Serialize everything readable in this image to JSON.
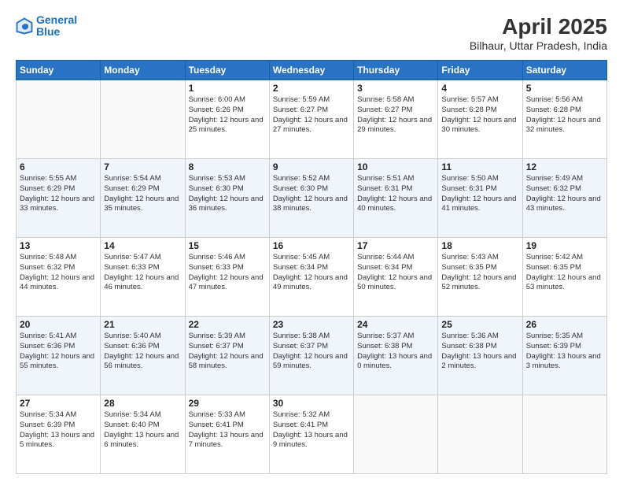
{
  "logo": {
    "line1": "General",
    "line2": "Blue"
  },
  "title": "April 2025",
  "location": "Bilhaur, Uttar Pradesh, India",
  "days": [
    "Sunday",
    "Monday",
    "Tuesday",
    "Wednesday",
    "Thursday",
    "Friday",
    "Saturday"
  ],
  "weeks": [
    [
      {
        "day": "",
        "sunrise": "",
        "sunset": "",
        "daylight": ""
      },
      {
        "day": "",
        "sunrise": "",
        "sunset": "",
        "daylight": ""
      },
      {
        "day": "1",
        "sunrise": "Sunrise: 6:00 AM",
        "sunset": "Sunset: 6:26 PM",
        "daylight": "Daylight: 12 hours and 25 minutes."
      },
      {
        "day": "2",
        "sunrise": "Sunrise: 5:59 AM",
        "sunset": "Sunset: 6:27 PM",
        "daylight": "Daylight: 12 hours and 27 minutes."
      },
      {
        "day": "3",
        "sunrise": "Sunrise: 5:58 AM",
        "sunset": "Sunset: 6:27 PM",
        "daylight": "Daylight: 12 hours and 29 minutes."
      },
      {
        "day": "4",
        "sunrise": "Sunrise: 5:57 AM",
        "sunset": "Sunset: 6:28 PM",
        "daylight": "Daylight: 12 hours and 30 minutes."
      },
      {
        "day": "5",
        "sunrise": "Sunrise: 5:56 AM",
        "sunset": "Sunset: 6:28 PM",
        "daylight": "Daylight: 12 hours and 32 minutes."
      }
    ],
    [
      {
        "day": "6",
        "sunrise": "Sunrise: 5:55 AM",
        "sunset": "Sunset: 6:29 PM",
        "daylight": "Daylight: 12 hours and 33 minutes."
      },
      {
        "day": "7",
        "sunrise": "Sunrise: 5:54 AM",
        "sunset": "Sunset: 6:29 PM",
        "daylight": "Daylight: 12 hours and 35 minutes."
      },
      {
        "day": "8",
        "sunrise": "Sunrise: 5:53 AM",
        "sunset": "Sunset: 6:30 PM",
        "daylight": "Daylight: 12 hours and 36 minutes."
      },
      {
        "day": "9",
        "sunrise": "Sunrise: 5:52 AM",
        "sunset": "Sunset: 6:30 PM",
        "daylight": "Daylight: 12 hours and 38 minutes."
      },
      {
        "day": "10",
        "sunrise": "Sunrise: 5:51 AM",
        "sunset": "Sunset: 6:31 PM",
        "daylight": "Daylight: 12 hours and 40 minutes."
      },
      {
        "day": "11",
        "sunrise": "Sunrise: 5:50 AM",
        "sunset": "Sunset: 6:31 PM",
        "daylight": "Daylight: 12 hours and 41 minutes."
      },
      {
        "day": "12",
        "sunrise": "Sunrise: 5:49 AM",
        "sunset": "Sunset: 6:32 PM",
        "daylight": "Daylight: 12 hours and 43 minutes."
      }
    ],
    [
      {
        "day": "13",
        "sunrise": "Sunrise: 5:48 AM",
        "sunset": "Sunset: 6:32 PM",
        "daylight": "Daylight: 12 hours and 44 minutes."
      },
      {
        "day": "14",
        "sunrise": "Sunrise: 5:47 AM",
        "sunset": "Sunset: 6:33 PM",
        "daylight": "Daylight: 12 hours and 46 minutes."
      },
      {
        "day": "15",
        "sunrise": "Sunrise: 5:46 AM",
        "sunset": "Sunset: 6:33 PM",
        "daylight": "Daylight: 12 hours and 47 minutes."
      },
      {
        "day": "16",
        "sunrise": "Sunrise: 5:45 AM",
        "sunset": "Sunset: 6:34 PM",
        "daylight": "Daylight: 12 hours and 49 minutes."
      },
      {
        "day": "17",
        "sunrise": "Sunrise: 5:44 AM",
        "sunset": "Sunset: 6:34 PM",
        "daylight": "Daylight: 12 hours and 50 minutes."
      },
      {
        "day": "18",
        "sunrise": "Sunrise: 5:43 AM",
        "sunset": "Sunset: 6:35 PM",
        "daylight": "Daylight: 12 hours and 52 minutes."
      },
      {
        "day": "19",
        "sunrise": "Sunrise: 5:42 AM",
        "sunset": "Sunset: 6:35 PM",
        "daylight": "Daylight: 12 hours and 53 minutes."
      }
    ],
    [
      {
        "day": "20",
        "sunrise": "Sunrise: 5:41 AM",
        "sunset": "Sunset: 6:36 PM",
        "daylight": "Daylight: 12 hours and 55 minutes."
      },
      {
        "day": "21",
        "sunrise": "Sunrise: 5:40 AM",
        "sunset": "Sunset: 6:36 PM",
        "daylight": "Daylight: 12 hours and 56 minutes."
      },
      {
        "day": "22",
        "sunrise": "Sunrise: 5:39 AM",
        "sunset": "Sunset: 6:37 PM",
        "daylight": "Daylight: 12 hours and 58 minutes."
      },
      {
        "day": "23",
        "sunrise": "Sunrise: 5:38 AM",
        "sunset": "Sunset: 6:37 PM",
        "daylight": "Daylight: 12 hours and 59 minutes."
      },
      {
        "day": "24",
        "sunrise": "Sunrise: 5:37 AM",
        "sunset": "Sunset: 6:38 PM",
        "daylight": "Daylight: 13 hours and 0 minutes."
      },
      {
        "day": "25",
        "sunrise": "Sunrise: 5:36 AM",
        "sunset": "Sunset: 6:38 PM",
        "daylight": "Daylight: 13 hours and 2 minutes."
      },
      {
        "day": "26",
        "sunrise": "Sunrise: 5:35 AM",
        "sunset": "Sunset: 6:39 PM",
        "daylight": "Daylight: 13 hours and 3 minutes."
      }
    ],
    [
      {
        "day": "27",
        "sunrise": "Sunrise: 5:34 AM",
        "sunset": "Sunset: 6:39 PM",
        "daylight": "Daylight: 13 hours and 5 minutes."
      },
      {
        "day": "28",
        "sunrise": "Sunrise: 5:34 AM",
        "sunset": "Sunset: 6:40 PM",
        "daylight": "Daylight: 13 hours and 6 minutes."
      },
      {
        "day": "29",
        "sunrise": "Sunrise: 5:33 AM",
        "sunset": "Sunset: 6:41 PM",
        "daylight": "Daylight: 13 hours and 7 minutes."
      },
      {
        "day": "30",
        "sunrise": "Sunrise: 5:32 AM",
        "sunset": "Sunset: 6:41 PM",
        "daylight": "Daylight: 13 hours and 9 minutes."
      },
      {
        "day": "",
        "sunrise": "",
        "sunset": "",
        "daylight": ""
      },
      {
        "day": "",
        "sunrise": "",
        "sunset": "",
        "daylight": ""
      },
      {
        "day": "",
        "sunrise": "",
        "sunset": "",
        "daylight": ""
      }
    ]
  ]
}
